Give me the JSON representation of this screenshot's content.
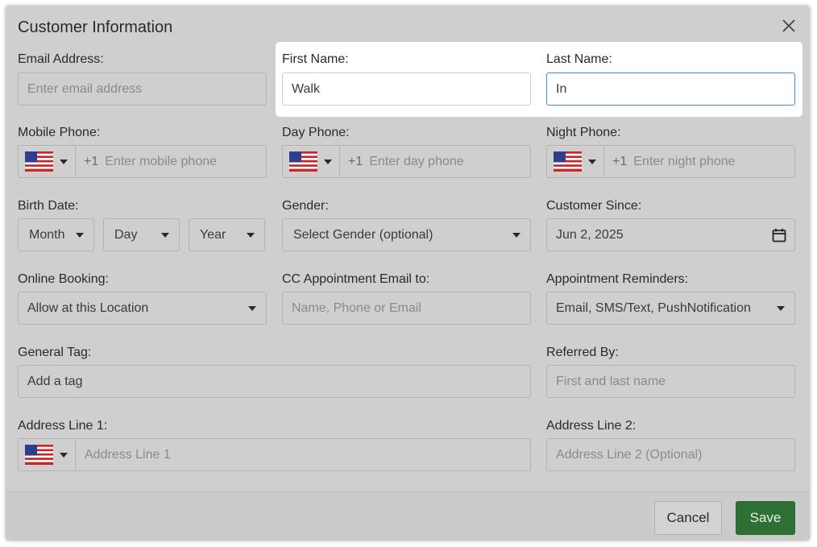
{
  "dialog": {
    "title": "Customer Information"
  },
  "email": {
    "label": "Email Address:",
    "placeholder": "Enter email address"
  },
  "first_name": {
    "label": "First Name:",
    "value": "Walk"
  },
  "last_name": {
    "label": "Last Name:",
    "value": "In"
  },
  "mobile_phone": {
    "label": "Mobile Phone:",
    "code": "+1",
    "placeholder": "Enter mobile phone"
  },
  "day_phone": {
    "label": "Day Phone:",
    "code": "+1",
    "placeholder": "Enter day phone"
  },
  "night_phone": {
    "label": "Night Phone:",
    "code": "+1",
    "placeholder": "Enter night phone"
  },
  "birth_date": {
    "label": "Birth Date:",
    "month": "Month",
    "day": "Day",
    "year": "Year"
  },
  "gender": {
    "label": "Gender:",
    "value": "Select Gender (optional)"
  },
  "customer_since": {
    "label": "Customer Since:",
    "value": "Jun 2, 2025"
  },
  "online_booking": {
    "label": "Online Booking:",
    "value": "Allow at this Location"
  },
  "cc_email": {
    "label": "CC Appointment Email to:",
    "placeholder": "Name, Phone or Email"
  },
  "reminders": {
    "label": "Appointment Reminders:",
    "value": "Email, SMS/Text, PushNotification"
  },
  "general_tag": {
    "label": "General Tag:",
    "value": "Add a tag"
  },
  "referred_by": {
    "label": "Referred By:",
    "placeholder": "First and last name"
  },
  "address1": {
    "label": "Address Line 1:",
    "placeholder": "Address Line 1"
  },
  "address2": {
    "label": "Address Line 2:",
    "placeholder": "Address Line 2 (Optional)"
  },
  "footer": {
    "cancel_label": "Cancel",
    "save_label": "Save"
  },
  "icons": {
    "close": "close-icon",
    "flag": "us-flag-icon",
    "calendar": "calendar-icon",
    "caret": "caret-down-icon"
  },
  "colors": {
    "accent_focus": "#3d8fd6",
    "save_button": "#2e7033",
    "backdrop": "#cfcfcf"
  }
}
